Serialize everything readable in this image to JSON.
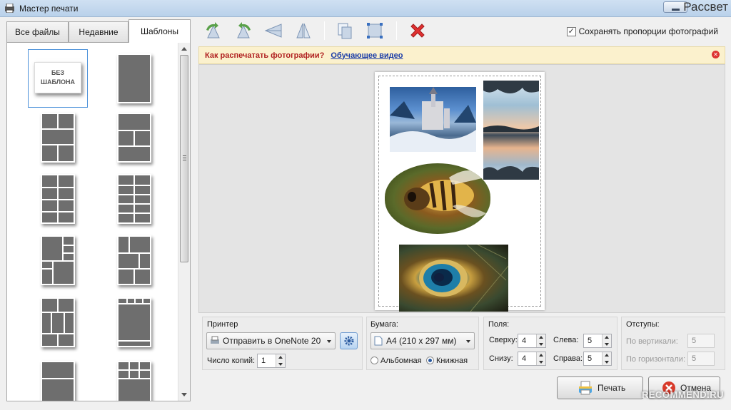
{
  "window": {
    "title": "Мастер печати",
    "brand_text": "Рассвет"
  },
  "tabs": [
    {
      "label": "Все файлы"
    },
    {
      "label": "Недавние"
    },
    {
      "label": "Шаблоны"
    }
  ],
  "templates": {
    "no_template_label": "БЕЗ ШАБЛОНА"
  },
  "toolbar": {
    "keep_ratio_label": "Сохранять пропорции фотографий",
    "keep_ratio_checked": true,
    "icons": [
      "rotate-left-icon",
      "rotate-right-icon",
      "flip-horizontal-icon",
      "flip-vertical-icon",
      "duplicate-icon",
      "fit-frame-icon",
      "delete-icon"
    ]
  },
  "infobar": {
    "question": "Как распечатать фотографии?",
    "link": "Обучающее видео"
  },
  "printer": {
    "group_label": "Принтер",
    "selected": "Отправить в OneNote 20",
    "copies_label": "Число копий:",
    "copies": "1"
  },
  "paper": {
    "group_label": "Бумага:",
    "selected": "A4 (210 x 297 мм)",
    "landscape_label": "Альбомная",
    "portrait_label": "Книжная",
    "orientation": "portrait"
  },
  "margins": {
    "group_label": "Поля:",
    "top_label": "Сверху:",
    "top": "4",
    "left_label": "Слева:",
    "left": "5",
    "bottom_label": "Снизу:",
    "bottom": "4",
    "right_label": "Справа:",
    "right": "5"
  },
  "spacing": {
    "group_label": "Отступы:",
    "vertical_label": "По вертикали:",
    "vertical": "5",
    "horizontal_label": "По горизонтали:",
    "horizontal": "5"
  },
  "actions": {
    "print_label": "Печать",
    "cancel_label": "Отмена"
  },
  "watermark": "RECOMMEND.RU",
  "colors": {
    "accent": "#4a90d9",
    "infobar_bg": "#fbf1cd",
    "question": "#b02020",
    "link": "#1a3ca8",
    "delete": "#e03030"
  }
}
